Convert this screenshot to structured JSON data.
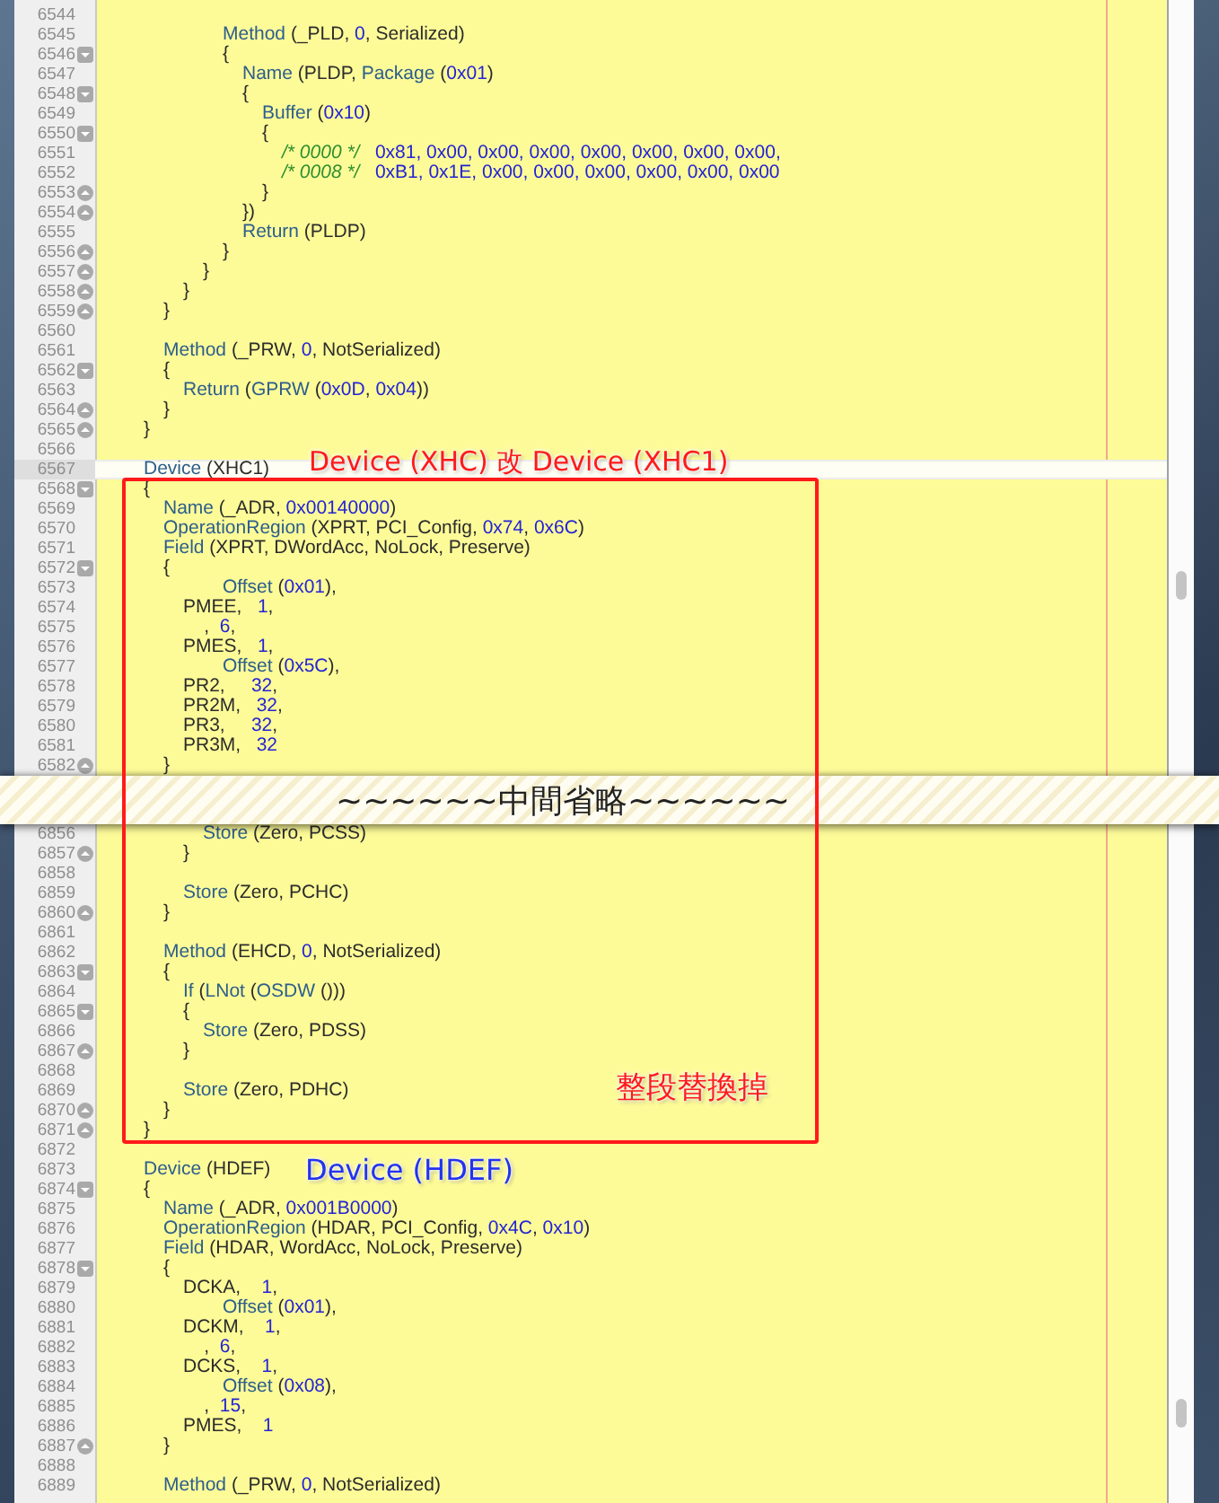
{
  "segments": [
    {
      "lines": [
        {
          "number": "6544",
          "kind": "plain",
          "current": false
        },
        {
          "number": "6545",
          "kind": "plain",
          "current": false,
          "tokens": [
            {
              "text": "\t\t\t\t\t\tMethod",
              "kind": "kw"
            },
            {
              "text": " (_PLD, ",
              "kind": "txt"
            },
            {
              "text": "0",
              "kind": "num"
            },
            {
              "text": ", Serialized)",
              "kind": "txt"
            }
          ]
        },
        {
          "number": "6546",
          "kind": "block_start",
          "current": false,
          "tokens": [
            {
              "text": "\t\t\t\t\t\t{",
              "kind": "txt"
            }
          ]
        },
        {
          "number": "6547",
          "kind": "plain",
          "current": false,
          "tokens": [
            {
              "text": "\t\t\t\t\t\t\tName",
              "kind": "kw"
            },
            {
              "text": " (PLDP, ",
              "kind": "txt"
            },
            {
              "text": "Package",
              "kind": "kw"
            },
            {
              "text": " (",
              "kind": "txt"
            },
            {
              "text": "0x01",
              "kind": "num"
            },
            {
              "text": ")",
              "kind": "txt"
            }
          ]
        },
        {
          "number": "6548",
          "kind": "block_start",
          "current": false,
          "tokens": [
            {
              "text": "\t\t\t\t\t\t\t{",
              "kind": "txt"
            }
          ]
        },
        {
          "number": "6549",
          "kind": "plain",
          "current": false,
          "tokens": [
            {
              "text": "\t\t\t\t\t\t\t\tBuffer",
              "kind": "kw"
            },
            {
              "text": " (",
              "kind": "txt"
            },
            {
              "text": "0x10",
              "kind": "num"
            },
            {
              "text": ")",
              "kind": "txt"
            }
          ]
        },
        {
          "number": "6550",
          "kind": "block_start",
          "current": false,
          "tokens": [
            {
              "text": "\t\t\t\t\t\t\t\t{",
              "kind": "txt"
            }
          ]
        },
        {
          "number": "6551",
          "kind": "plain",
          "current": false,
          "tokens": [
            {
              "text": "\t\t\t\t\t\t\t\t\t/* 0000 */   ",
              "kind": "com"
            },
            {
              "text": "0x81, 0x00, 0x00, 0x00, 0x00, 0x00, 0x00, 0x00,",
              "kind": "num"
            }
          ]
        },
        {
          "number": "6552",
          "kind": "plain",
          "current": false,
          "tokens": [
            {
              "text": "\t\t\t\t\t\t\t\t\t/* 0008 */   ",
              "kind": "com"
            },
            {
              "text": "0xB1, 0x1E, 0x00, 0x00, 0x00, 0x00, 0x00, 0x00",
              "kind": "num"
            }
          ]
        },
        {
          "number": "6553",
          "kind": "block_end",
          "current": false,
          "tokens": [
            {
              "text": "\t\t\t\t\t\t\t\t}",
              "kind": "txt"
            }
          ]
        },
        {
          "number": "6554",
          "kind": "block_end",
          "current": false,
          "tokens": [
            {
              "text": "\t\t\t\t\t\t\t})",
              "kind": "txt"
            }
          ]
        },
        {
          "number": "6555",
          "kind": "plain",
          "current": false,
          "tokens": [
            {
              "text": "\t\t\t\t\t\t\tReturn",
              "kind": "kw"
            },
            {
              "text": " (PLDP)",
              "kind": "txt"
            }
          ]
        },
        {
          "number": "6556",
          "kind": "block_end",
          "current": false,
          "tokens": [
            {
              "text": "\t\t\t\t\t\t}",
              "kind": "txt"
            }
          ]
        },
        {
          "number": "6557",
          "kind": "block_end",
          "current": false,
          "tokens": [
            {
              "text": "\t\t\t\t\t}",
              "kind": "txt"
            }
          ]
        },
        {
          "number": "6558",
          "kind": "block_end",
          "current": false,
          "tokens": [
            {
              "text": "\t\t\t\t}",
              "kind": "txt"
            }
          ]
        },
        {
          "number": "6559",
          "kind": "block_end",
          "current": false,
          "tokens": [
            {
              "text": "\t\t\t}",
              "kind": "txt"
            }
          ]
        },
        {
          "number": "6560",
          "kind": "plain",
          "current": false
        },
        {
          "number": "6561",
          "kind": "plain",
          "current": false,
          "tokens": [
            {
              "text": "\t\t\tMethod",
              "kind": "kw"
            },
            {
              "text": " (_PRW, ",
              "kind": "txt"
            },
            {
              "text": "0",
              "kind": "num"
            },
            {
              "text": ", NotSerialized)",
              "kind": "txt"
            }
          ]
        },
        {
          "number": "6562",
          "kind": "block_start",
          "current": false,
          "tokens": [
            {
              "text": "\t\t\t{",
              "kind": "txt"
            }
          ]
        },
        {
          "number": "6563",
          "kind": "plain",
          "current": false,
          "tokens": [
            {
              "text": "\t\t\t\tReturn",
              "kind": "kw"
            },
            {
              "text": " (",
              "kind": "txt"
            },
            {
              "text": "GPRW",
              "kind": "kw"
            },
            {
              "text": " (",
              "kind": "txt"
            },
            {
              "text": "0x0D",
              "kind": "num"
            },
            {
              "text": ", ",
              "kind": "txt"
            },
            {
              "text": "0x04",
              "kind": "num"
            },
            {
              "text": "))",
              "kind": "txt"
            }
          ]
        },
        {
          "number": "6564",
          "kind": "block_end",
          "current": false,
          "tokens": [
            {
              "text": "\t\t\t}",
              "kind": "txt"
            }
          ]
        },
        {
          "number": "6565",
          "kind": "block_end",
          "current": false,
          "tokens": [
            {
              "text": "\t\t}",
              "kind": "txt"
            }
          ]
        },
        {
          "number": "6566",
          "kind": "plain",
          "current": false
        },
        {
          "number": "6567",
          "kind": "plain",
          "current": true,
          "tokens": [
            {
              "text": "\t\tDevice",
              "kind": "kw"
            },
            {
              "text": " (XHC1)",
              "kind": "txt"
            }
          ]
        },
        {
          "number": "6568",
          "kind": "block_start",
          "current": false,
          "tokens": [
            {
              "text": "\t\t{",
              "kind": "txt"
            }
          ]
        },
        {
          "number": "6569",
          "kind": "plain",
          "current": false,
          "tokens": [
            {
              "text": "\t\t\tName",
              "kind": "kw"
            },
            {
              "text": " (_ADR, ",
              "kind": "txt"
            },
            {
              "text": "0x00140000",
              "kind": "num"
            },
            {
              "text": ")",
              "kind": "txt"
            }
          ]
        },
        {
          "number": "6570",
          "kind": "plain",
          "current": false,
          "tokens": [
            {
              "text": "\t\t\tOperationRegion",
              "kind": "kw"
            },
            {
              "text": " (XPRT, PCI_Config, ",
              "kind": "txt"
            },
            {
              "text": "0x74",
              "kind": "num"
            },
            {
              "text": ", ",
              "kind": "txt"
            },
            {
              "text": "0x6C",
              "kind": "num"
            },
            {
              "text": ")",
              "kind": "txt"
            }
          ]
        },
        {
          "number": "6571",
          "kind": "plain",
          "current": false,
          "tokens": [
            {
              "text": "\t\t\tField",
              "kind": "kw"
            },
            {
              "text": " (XPRT, DWordAcc, NoLock, Preserve)",
              "kind": "txt"
            }
          ]
        },
        {
          "number": "6572",
          "kind": "block_start",
          "current": false,
          "tokens": [
            {
              "text": "\t\t\t{",
              "kind": "txt"
            }
          ]
        },
        {
          "number": "6573",
          "kind": "plain",
          "current": false,
          "tokens": [
            {
              "text": "\t\t\t\t\t\tOffset",
              "kind": "kw"
            },
            {
              "text": " (",
              "kind": "txt"
            },
            {
              "text": "0x01",
              "kind": "num"
            },
            {
              "text": "),",
              "kind": "txt"
            }
          ]
        },
        {
          "number": "6574",
          "kind": "plain",
          "current": false,
          "tokens": [
            {
              "text": "\t\t\t\tPMEE,   ",
              "kind": "txt"
            },
            {
              "text": "1",
              "kind": "num"
            },
            {
              "text": ",",
              "kind": "txt"
            }
          ]
        },
        {
          "number": "6575",
          "kind": "plain",
          "current": false,
          "tokens": [
            {
              "text": "\t\t\t\t    ,  ",
              "kind": "txt"
            },
            {
              "text": "6",
              "kind": "num"
            },
            {
              "text": ",",
              "kind": "txt"
            }
          ]
        },
        {
          "number": "6576",
          "kind": "plain",
          "current": false,
          "tokens": [
            {
              "text": "\t\t\t\tPMES,   ",
              "kind": "txt"
            },
            {
              "text": "1",
              "kind": "num"
            },
            {
              "text": ",",
              "kind": "txt"
            }
          ]
        },
        {
          "number": "6577",
          "kind": "plain",
          "current": false,
          "tokens": [
            {
              "text": "\t\t\t\t\t\tOffset",
              "kind": "kw"
            },
            {
              "text": " (",
              "kind": "txt"
            },
            {
              "text": "0x5C",
              "kind": "num"
            },
            {
              "text": "),",
              "kind": "txt"
            }
          ]
        },
        {
          "number": "6578",
          "kind": "plain",
          "current": false,
          "tokens": [
            {
              "text": "\t\t\t\tPR2,     ",
              "kind": "txt"
            },
            {
              "text": "32",
              "kind": "num"
            },
            {
              "text": ",",
              "kind": "txt"
            }
          ]
        },
        {
          "number": "6579",
          "kind": "plain",
          "current": false,
          "tokens": [
            {
              "text": "\t\t\t\tPR2M,   ",
              "kind": "txt"
            },
            {
              "text": "32",
              "kind": "num"
            },
            {
              "text": ",",
              "kind": "txt"
            }
          ]
        },
        {
          "number": "6580",
          "kind": "plain",
          "current": false,
          "tokens": [
            {
              "text": "\t\t\t\tPR3,     ",
              "kind": "txt"
            },
            {
              "text": "32",
              "kind": "num"
            },
            {
              "text": ",",
              "kind": "txt"
            }
          ]
        },
        {
          "number": "6581",
          "kind": "plain",
          "current": false,
          "tokens": [
            {
              "text": "\t\t\t\tPR3M,   ",
              "kind": "txt"
            },
            {
              "text": "32",
              "kind": "num"
            }
          ]
        },
        {
          "number": "6582",
          "kind": "block_end",
          "current": false,
          "tokens": [
            {
              "text": "\t\t\t}",
              "kind": "txt"
            }
          ]
        }
      ]
    },
    {
      "lines": [
        {
          "number": "6856",
          "kind": "plain",
          "current": false,
          "tokens": [
            {
              "text": "\t\t\t\t\tStore",
              "kind": "kw"
            },
            {
              "text": " (Zero, PCSS)",
              "kind": "txt"
            }
          ]
        },
        {
          "number": "6857",
          "kind": "block_end",
          "current": false,
          "tokens": [
            {
              "text": "\t\t\t\t}",
              "kind": "txt"
            }
          ]
        },
        {
          "number": "6858",
          "kind": "plain",
          "current": false
        },
        {
          "number": "6859",
          "kind": "plain",
          "current": false,
          "tokens": [
            {
              "text": "\t\t\t\tStore",
              "kind": "kw"
            },
            {
              "text": " (Zero, PCHC)",
              "kind": "txt"
            }
          ]
        },
        {
          "number": "6860",
          "kind": "block_end",
          "current": false,
          "tokens": [
            {
              "text": "\t\t\t}",
              "kind": "txt"
            }
          ]
        },
        {
          "number": "6861",
          "kind": "plain",
          "current": false
        },
        {
          "number": "6862",
          "kind": "plain",
          "current": false,
          "tokens": [
            {
              "text": "\t\t\tMethod",
              "kind": "kw"
            },
            {
              "text": " (EHCD, ",
              "kind": "txt"
            },
            {
              "text": "0",
              "kind": "num"
            },
            {
              "text": ", NotSerialized)",
              "kind": "txt"
            }
          ]
        },
        {
          "number": "6863",
          "kind": "block_start",
          "current": false,
          "tokens": [
            {
              "text": "\t\t\t{",
              "kind": "txt"
            }
          ]
        },
        {
          "number": "6864",
          "kind": "plain",
          "current": false,
          "tokens": [
            {
              "text": "\t\t\t\tIf",
              "kind": "kw"
            },
            {
              "text": " (",
              "kind": "txt"
            },
            {
              "text": "LNot",
              "kind": "kw"
            },
            {
              "text": " (",
              "kind": "txt"
            },
            {
              "text": "OSDW",
              "kind": "kw"
            },
            {
              "text": " ()))",
              "kind": "txt"
            }
          ]
        },
        {
          "number": "6865",
          "kind": "block_start",
          "current": false,
          "tokens": [
            {
              "text": "\t\t\t\t{",
              "kind": "txt"
            }
          ]
        },
        {
          "number": "6866",
          "kind": "plain",
          "current": false,
          "tokens": [
            {
              "text": "\t\t\t\t\tStore",
              "kind": "kw"
            },
            {
              "text": " (Zero, PDSS)",
              "kind": "txt"
            }
          ]
        },
        {
          "number": "6867",
          "kind": "block_end",
          "current": false,
          "tokens": [
            {
              "text": "\t\t\t\t}",
              "kind": "txt"
            }
          ]
        },
        {
          "number": "6868",
          "kind": "plain",
          "current": false
        },
        {
          "number": "6869",
          "kind": "plain",
          "current": false,
          "tokens": [
            {
              "text": "\t\t\t\tStore",
              "kind": "kw"
            },
            {
              "text": " (Zero, PDHC)",
              "kind": "txt"
            }
          ]
        },
        {
          "number": "6870",
          "kind": "block_end",
          "current": false,
          "tokens": [
            {
              "text": "\t\t\t}",
              "kind": "txt"
            }
          ]
        },
        {
          "number": "6871",
          "kind": "block_end",
          "current": false,
          "tokens": [
            {
              "text": "\t\t}",
              "kind": "txt"
            }
          ]
        },
        {
          "number": "6872",
          "kind": "plain",
          "current": false
        },
        {
          "number": "6873",
          "kind": "plain",
          "current": false,
          "tokens": [
            {
              "text": "\t\tDevice",
              "kind": "kw"
            },
            {
              "text": " (HDEF)",
              "kind": "txt"
            }
          ]
        },
        {
          "number": "6874",
          "kind": "block_start",
          "current": false,
          "tokens": [
            {
              "text": "\t\t{",
              "kind": "txt"
            }
          ]
        },
        {
          "number": "6875",
          "kind": "plain",
          "current": false,
          "tokens": [
            {
              "text": "\t\t\tName",
              "kind": "kw"
            },
            {
              "text": " (_ADR, ",
              "kind": "txt"
            },
            {
              "text": "0x001B0000",
              "kind": "num"
            },
            {
              "text": ")",
              "kind": "txt"
            }
          ]
        },
        {
          "number": "6876",
          "kind": "plain",
          "current": false,
          "tokens": [
            {
              "text": "\t\t\tOperationRegion",
              "kind": "kw"
            },
            {
              "text": " (HDAR, PCI_Config, ",
              "kind": "txt"
            },
            {
              "text": "0x4C",
              "kind": "num"
            },
            {
              "text": ", ",
              "kind": "txt"
            },
            {
              "text": "0x10",
              "kind": "num"
            },
            {
              "text": ")",
              "kind": "txt"
            }
          ]
        },
        {
          "number": "6877",
          "kind": "plain",
          "current": false,
          "tokens": [
            {
              "text": "\t\t\tField",
              "kind": "kw"
            },
            {
              "text": " (HDAR, WordAcc, NoLock, Preserve)",
              "kind": "txt"
            }
          ]
        },
        {
          "number": "6878",
          "kind": "block_start",
          "current": false,
          "tokens": [
            {
              "text": "\t\t\t{",
              "kind": "txt"
            }
          ]
        },
        {
          "number": "6879",
          "kind": "plain",
          "current": false,
          "tokens": [
            {
              "text": "\t\t\t\tDCKA,    ",
              "kind": "txt"
            },
            {
              "text": "1",
              "kind": "num"
            },
            {
              "text": ",",
              "kind": "txt"
            }
          ]
        },
        {
          "number": "6880",
          "kind": "plain",
          "current": false,
          "tokens": [
            {
              "text": "\t\t\t\t\t\tOffset",
              "kind": "kw"
            },
            {
              "text": " (",
              "kind": "txt"
            },
            {
              "text": "0x01",
              "kind": "num"
            },
            {
              "text": "),",
              "kind": "txt"
            }
          ]
        },
        {
          "number": "6881",
          "kind": "plain",
          "current": false,
          "tokens": [
            {
              "text": "\t\t\t\tDCKM,    ",
              "kind": "txt"
            },
            {
              "text": "1",
              "kind": "num"
            },
            {
              "text": ",",
              "kind": "txt"
            }
          ]
        },
        {
          "number": "6882",
          "kind": "plain",
          "current": false,
          "tokens": [
            {
              "text": "\t\t\t\t    ,  ",
              "kind": "txt"
            },
            {
              "text": "6",
              "kind": "num"
            },
            {
              "text": ",",
              "kind": "txt"
            }
          ]
        },
        {
          "number": "6883",
          "kind": "plain",
          "current": false,
          "tokens": [
            {
              "text": "\t\t\t\tDCKS,    ",
              "kind": "txt"
            },
            {
              "text": "1",
              "kind": "num"
            },
            {
              "text": ",",
              "kind": "txt"
            }
          ]
        },
        {
          "number": "6884",
          "kind": "plain",
          "current": false,
          "tokens": [
            {
              "text": "\t\t\t\t\t\tOffset",
              "kind": "kw"
            },
            {
              "text": " (",
              "kind": "txt"
            },
            {
              "text": "0x08",
              "kind": "num"
            },
            {
              "text": "),",
              "kind": "txt"
            }
          ]
        },
        {
          "number": "6885",
          "kind": "plain",
          "current": false,
          "tokens": [
            {
              "text": "\t\t\t\t    ,  ",
              "kind": "txt"
            },
            {
              "text": "15",
              "kind": "num"
            },
            {
              "text": ",",
              "kind": "txt"
            }
          ]
        },
        {
          "number": "6886",
          "kind": "plain",
          "current": false,
          "tokens": [
            {
              "text": "\t\t\t\tPMES,    ",
              "kind": "txt"
            },
            {
              "text": "1",
              "kind": "num"
            }
          ]
        },
        {
          "number": "6887",
          "kind": "block_end",
          "current": false,
          "tokens": [
            {
              "text": "\t\t\t}",
              "kind": "txt"
            }
          ]
        },
        {
          "number": "6888",
          "kind": "plain",
          "current": false
        },
        {
          "number": "6889",
          "kind": "plain",
          "current": false,
          "tokens": [
            {
              "text": "\t\t\tMethod",
              "kind": "kw"
            },
            {
              "text": " (_PRW, ",
              "kind": "txt"
            },
            {
              "text": "0",
              "kind": "num"
            },
            {
              "text": ", NotSerialized)",
              "kind": "txt"
            }
          ]
        }
      ]
    }
  ],
  "omission_banner": {
    "text": "~~~~~~中間省略~~~~~~"
  },
  "annotations": [
    {
      "kind": "label",
      "text": "Device (XHC) 改 Device (XHC1)",
      "color": "#ff1a1a"
    },
    {
      "kind": "frame",
      "color": "#ff1a1a"
    },
    {
      "kind": "label",
      "text": "整段替換掉",
      "color": "#ff1a1a"
    },
    {
      "kind": "label",
      "text": "Device (HDEF)",
      "color": "#2233ee"
    }
  ]
}
